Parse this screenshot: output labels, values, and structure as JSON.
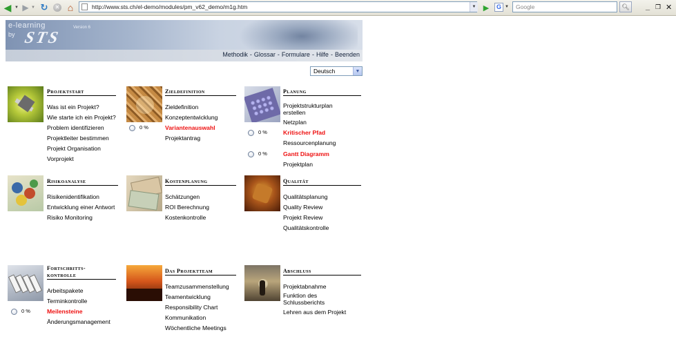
{
  "browser": {
    "url": "http://www.sts.ch/el-demo/modules/pm_v62_demo/m1g.htm",
    "search_placeholder": "Google",
    "search_engine_letter": "G"
  },
  "header": {
    "logo_line1": "e-learning",
    "logo_line2": "by",
    "logo_brand": "STS",
    "version": "Version 6",
    "nav": [
      "Methodik",
      "Glossar",
      "Formulare",
      "Hilfe",
      "Beenden"
    ],
    "nav_separator": "-"
  },
  "language": {
    "selected": "Deutsch"
  },
  "modules": {
    "projektstart": {
      "title": "Projektstart",
      "links": [
        "Was ist ein Projekt?",
        "Wie starte ich ein Projekt?",
        "Problem identifizieren",
        "Projektleiter bestimmen",
        "Projekt Organisation",
        "Vorprojekt"
      ]
    },
    "zieldefinition": {
      "title": "Zieldefinition",
      "links": [
        "Zieldefinition",
        "Konzeptentwicklung",
        "Variantenauswahl",
        "Projektantrag"
      ],
      "progress": "0 %"
    },
    "planung": {
      "title": "Planung",
      "links": [
        "Projektstrukturplan erstellen",
        "Netzplan",
        "Kritischer Pfad",
        "Ressourcenplanung",
        "Gantt Diagramm",
        "Projektplan"
      ],
      "progress1": "0 %",
      "progress2": "0 %"
    },
    "risikoanalyse": {
      "title": "Risikoanalyse",
      "links": [
        "Risikenidentifikation",
        "Entwicklung einer Antwort",
        "Risiko Monitoring"
      ]
    },
    "kostenplanung": {
      "title": "Kostenplanung",
      "links": [
        "Schätzungen",
        "ROI Berechnung",
        "Kostenkontrolle"
      ]
    },
    "qualitaet": {
      "title": "Qualität",
      "links": [
        "Qualitätsplanung",
        "Quality Review",
        "Projekt Review",
        "Qualitätskontrolle"
      ]
    },
    "fortschrittskontrolle": {
      "title_line1": "Fortschritts-",
      "title_line2": "kontrolle",
      "links": [
        "Arbeitspakete",
        "Terminkontrolle",
        "Meilensteine",
        "Änderungsmanagement"
      ],
      "progress": "0 %"
    },
    "projektteam": {
      "title": "Das Projektteam",
      "links": [
        "Teamzusammenstellung",
        "Teamentwicklung",
        "Responsibility Chart",
        "Kommunikation",
        "Wöchentliche Meetings"
      ]
    },
    "abschluss": {
      "title": "Abschluss",
      "links": [
        "Projektabnahme",
        "Funktion des Schlussberichts",
        "Lehren aus dem Projekt"
      ]
    }
  },
  "colors": {
    "highlight_link": "#ee1010",
    "banner": "#8fa2c0"
  }
}
